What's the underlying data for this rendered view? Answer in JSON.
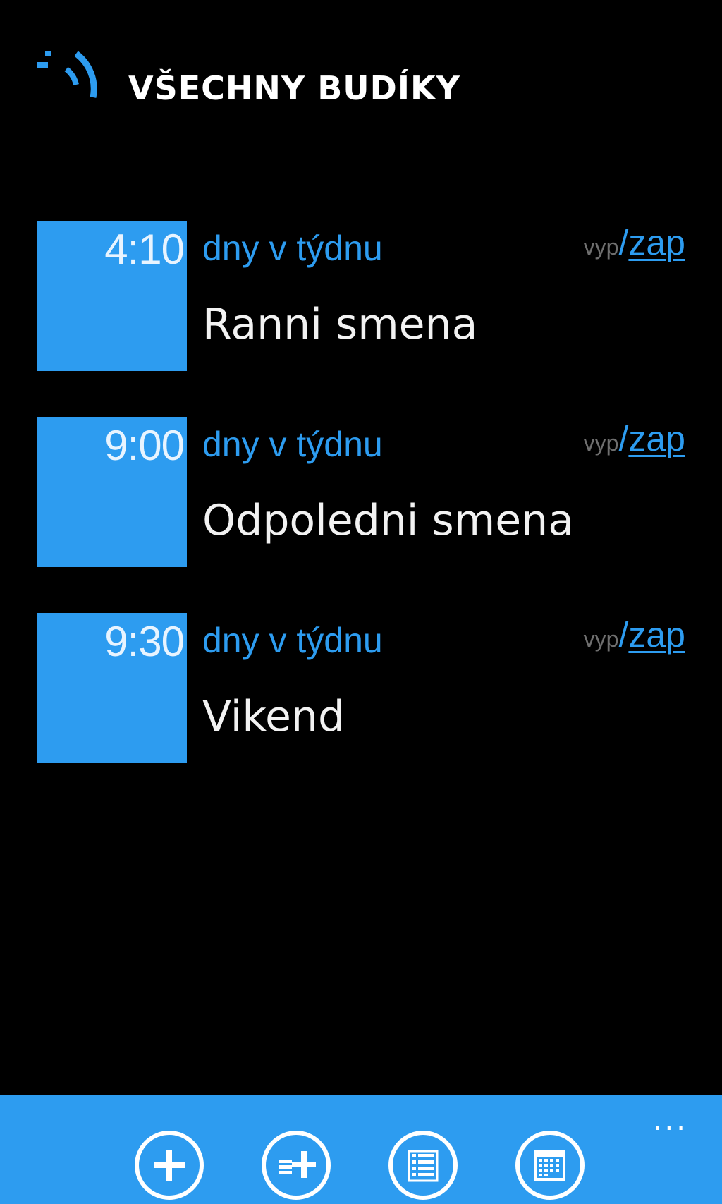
{
  "header": {
    "title": "VŠECHNY BUDÍKY",
    "logo_icon": "alarm-logo-icon"
  },
  "alarms": [
    {
      "time": "4:10",
      "days": "dny v týdnu",
      "name": "Ranni smena",
      "toggle_off": "vyp",
      "toggle_slash": "/",
      "toggle_on": "zap"
    },
    {
      "time": "9:00",
      "days": "dny v týdnu",
      "name": "Odpoledni smena",
      "toggle_off": "vyp",
      "toggle_slash": "/",
      "toggle_on": "zap"
    },
    {
      "time": "9:30",
      "days": "dny v týdnu",
      "name": "Vikend",
      "toggle_off": "vyp",
      "toggle_slash": "/",
      "toggle_on": "zap"
    }
  ],
  "app_bar": {
    "buttons": [
      "add-icon",
      "add-list-icon",
      "list-icon",
      "calendar-icon"
    ],
    "more": "..."
  },
  "colors": {
    "accent": "#2d9cf0",
    "background": "#000000",
    "inactive": "#6f6f6f"
  }
}
